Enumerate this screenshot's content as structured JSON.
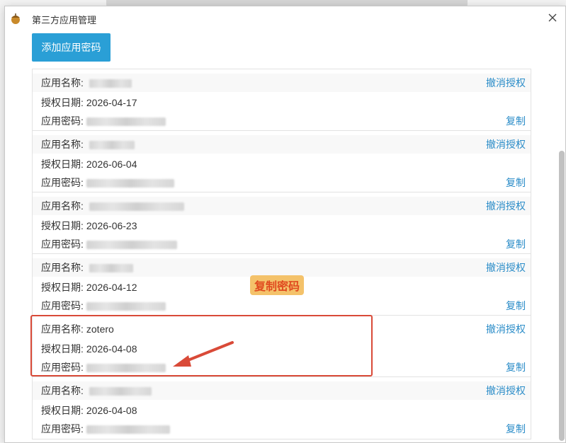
{
  "dialog": {
    "title": "第三方应用管理",
    "add_button_label": "添加应用密码"
  },
  "labels": {
    "app_name": "应用名称:",
    "auth_date": "授权日期:",
    "app_password": "应用密码:",
    "revoke": "撤消授权",
    "copy": "复制"
  },
  "entries": [
    {
      "name": "",
      "date": "2026-04-17"
    },
    {
      "name": "",
      "date": "2026-06-04"
    },
    {
      "name": "",
      "date": "2026-06-23"
    },
    {
      "name": "",
      "date": "2026-04-12"
    },
    {
      "name": "zotero",
      "date": "2026-04-08"
    },
    {
      "name": "",
      "date": "2026-04-08"
    }
  ],
  "annotation": {
    "label": "复制密码",
    "color": "#d94a38"
  }
}
